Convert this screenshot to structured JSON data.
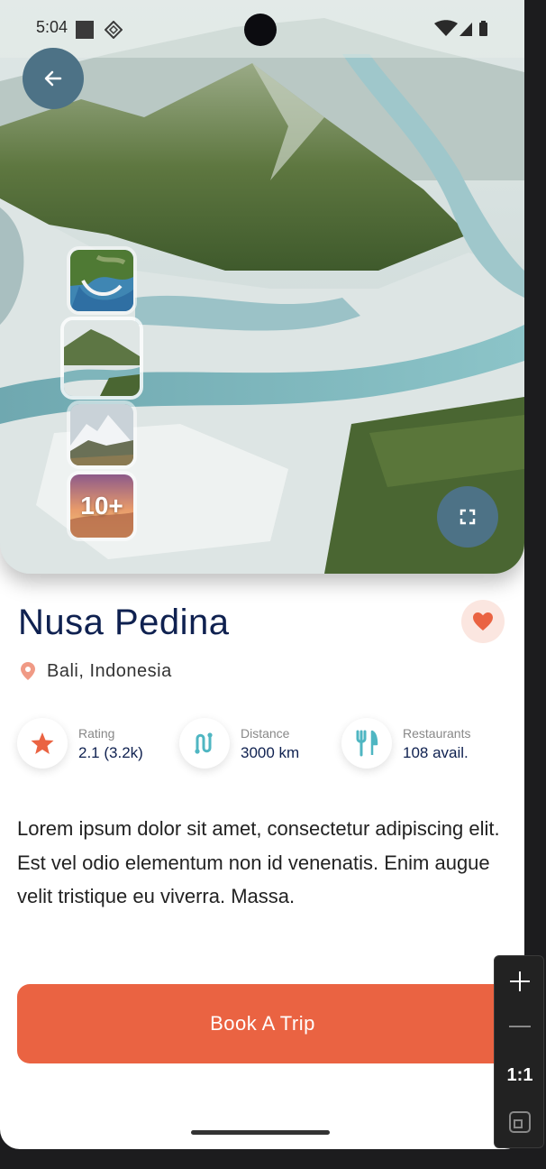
{
  "status_bar": {
    "time": "5:04"
  },
  "place": {
    "name": "Nusa Pedina",
    "location": "Bali, Indonesia"
  },
  "gallery": {
    "more_label": "10+"
  },
  "stats": [
    {
      "icon": "star-icon",
      "label": "Rating",
      "value": "2.1 (3.2k)"
    },
    {
      "icon": "route-icon",
      "label": "Distance",
      "value": "3000 km"
    },
    {
      "icon": "fork-knife-icon",
      "label": "Restaurants",
      "value": "108 avail."
    }
  ],
  "description": "Lorem ipsum dolor sit amet, consectetur adipiscing elit. Est vel odio elementum non id venenatis. Enim augue velit tristique eu viverra. Massa.",
  "cta": {
    "label": "Book A Trip"
  },
  "zoom_controls": {
    "reset_label": "1:1"
  },
  "colors": {
    "accent": "#ea6342",
    "primary": "#4d7286",
    "title": "#0f2150",
    "favorite_bg": "#fbe6e0"
  }
}
